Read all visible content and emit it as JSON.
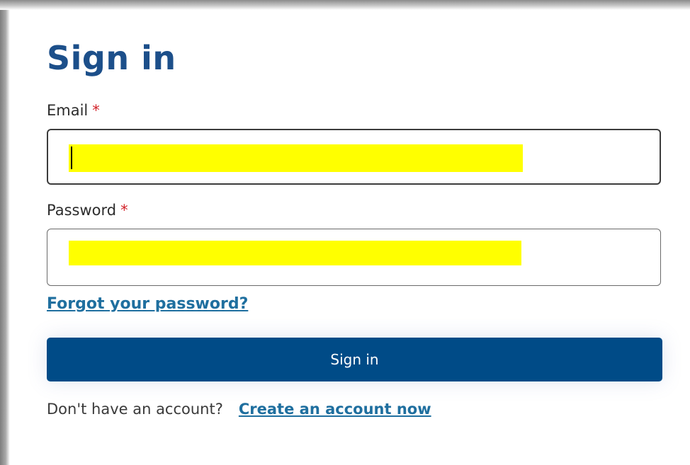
{
  "form": {
    "title": "Sign in",
    "email_label": "Email",
    "email_required_marker": "*",
    "password_label": "Password",
    "password_required_marker": "*",
    "forgot_password_link": "Forgot your password?",
    "submit_label": "Sign in",
    "no_account_text": "Don't have an account?",
    "create_account_link": "Create an account now"
  },
  "colors": {
    "title": "#1c4f8a",
    "button": "#004b87",
    "link": "#1f6f9f",
    "required": "#d2232a",
    "redaction": "#ffff00"
  }
}
